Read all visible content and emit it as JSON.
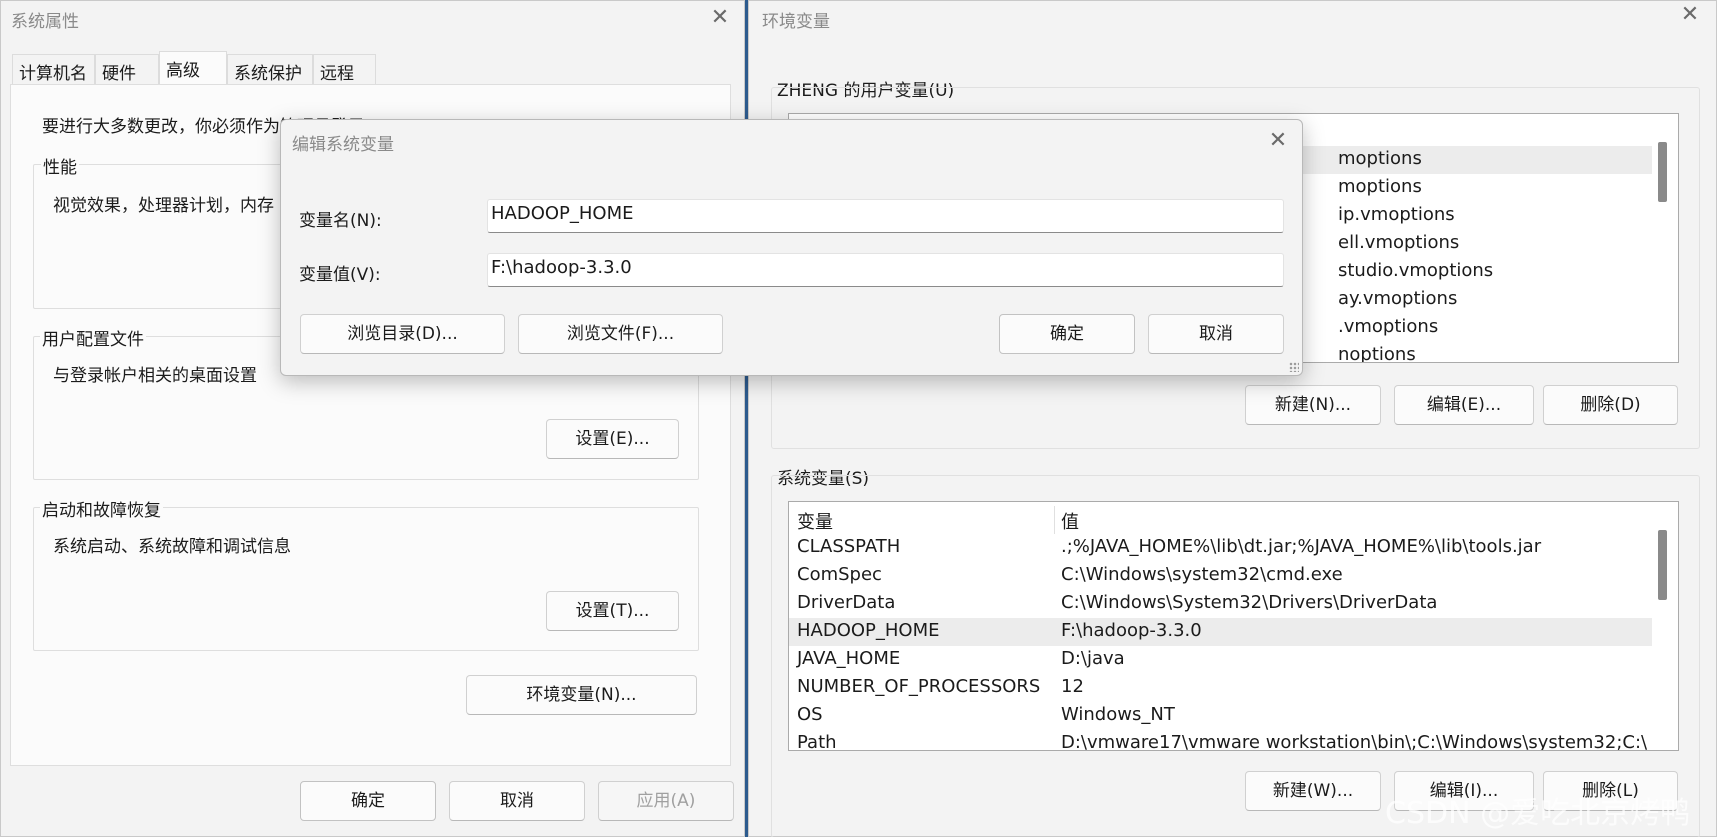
{
  "sysprops": {
    "title": "系统属性",
    "close": "✕",
    "tabs": [
      "计算机名",
      "硬件",
      "高级",
      "系统保护",
      "远程"
    ],
    "admin_note": "要进行大多数更改，你必须作为管理员登录。",
    "perf_label": "性能",
    "perf_desc": "视觉效果，处理器计划，内存",
    "profile_label": "用户配置文件",
    "profile_desc": "与登录帐户相关的桌面设置",
    "profile_btn": "设置(E)...",
    "startup_label": "启动和故障恢复",
    "startup_desc": "系统启动、系统故障和调试信息",
    "startup_btn": "设置(T)...",
    "env_btn": "环境变量(N)...",
    "ok": "确定",
    "cancel": "取消",
    "apply": "应用(A)"
  },
  "envvars": {
    "title": "环境变量",
    "close": "✕",
    "user_label": "ZHENG 的用户变量(U)",
    "user_rows": [
      "moptions",
      "moptions",
      "ip.vmoptions",
      "ell.vmoptions",
      "studio.vmoptions",
      "ay.vmoptions",
      ".vmoptions",
      "noptions"
    ],
    "user_new": "新建(N)...",
    "user_edit": "编辑(E)...",
    "user_delete": "删除(D)",
    "sys_label": "系统变量(S)",
    "col_var": "变量",
    "col_val": "值",
    "sys_rows": [
      {
        "name": "CLASSPATH",
        "value": ".;%JAVA_HOME%\\lib\\dt.jar;%JAVA_HOME%\\lib\\tools.jar"
      },
      {
        "name": "ComSpec",
        "value": "C:\\Windows\\system32\\cmd.exe"
      },
      {
        "name": "DriverData",
        "value": "C:\\Windows\\System32\\Drivers\\DriverData"
      },
      {
        "name": "HADOOP_HOME",
        "value": "F:\\hadoop-3.3.0"
      },
      {
        "name": "JAVA_HOME",
        "value": "D:\\java"
      },
      {
        "name": "NUMBER_OF_PROCESSORS",
        "value": "12"
      },
      {
        "name": "OS",
        "value": "Windows_NT"
      },
      {
        "name": "Path",
        "value": "D:\\vmware17\\vmware workstation\\bin\\;C:\\Windows\\system32;C:\\"
      }
    ],
    "selected_sys_row": "HADOOP_HOME",
    "sys_new": "新建(W)...",
    "sys_edit": "编辑(I)...",
    "sys_delete": "删除(L)"
  },
  "editdlg": {
    "title": "编辑系统变量",
    "close": "✕",
    "name_label": "变量名(N):",
    "name_value": "HADOOP_HOME",
    "value_label": "变量值(V):",
    "value_value": "F:\\hadoop-3.3.0",
    "browse_dir": "浏览目录(D)...",
    "browse_file": "浏览文件(F)...",
    "ok": "确定",
    "cancel": "取消"
  },
  "watermark": "CSDN @爱吃北京烤鸭"
}
